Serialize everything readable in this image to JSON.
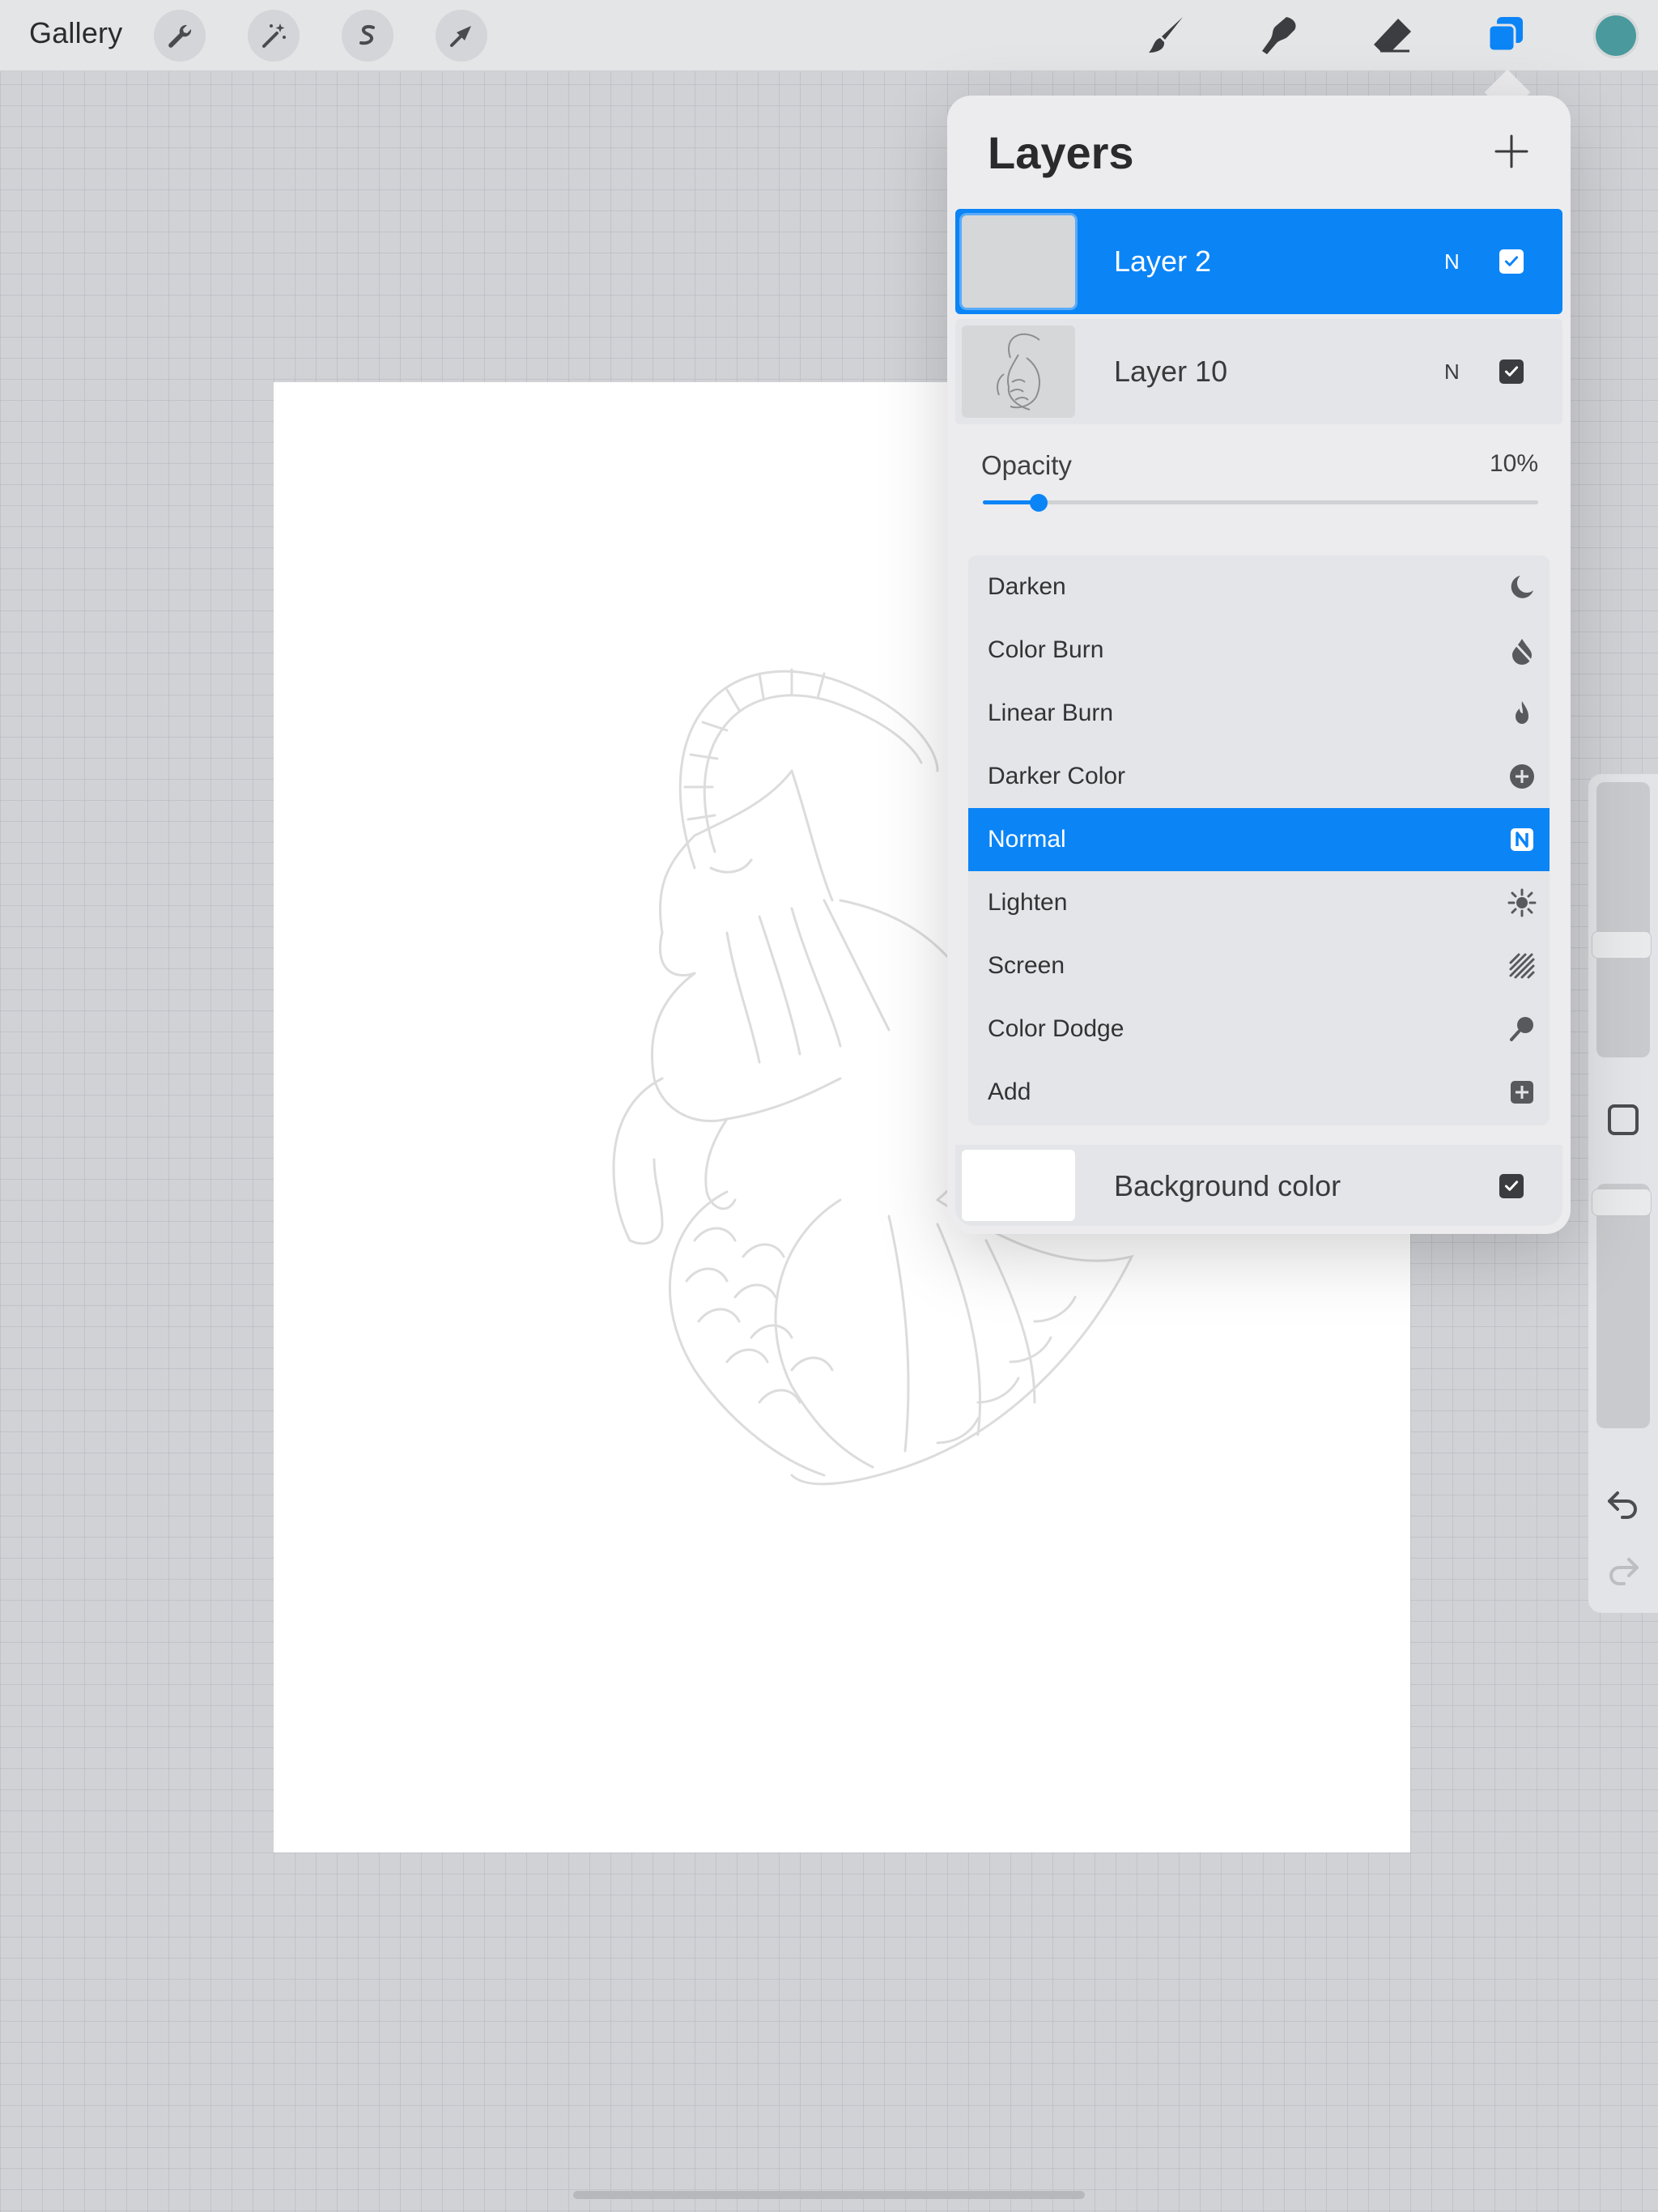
{
  "toolbar": {
    "gallery_label": "Gallery",
    "left_tools": [
      "wrench-icon",
      "magic-wand-icon",
      "selection-icon",
      "transform-arrow-icon"
    ],
    "right_tools": [
      "brush-icon",
      "smudge-icon",
      "eraser-icon",
      "layers-icon"
    ],
    "active_tool": "layers-icon",
    "current_color": "#4a9a9d",
    "accent_color": "#0b84f6"
  },
  "layers_panel": {
    "title": "Layers",
    "add_icon": "plus-icon",
    "layers": [
      {
        "name": "Layer 2",
        "blend": "N",
        "visible": true,
        "selected": true
      },
      {
        "name": "Layer 10",
        "blend": "N",
        "visible": true,
        "selected": false
      }
    ],
    "opacity": {
      "label": "Opacity",
      "value": "10%",
      "fraction": 0.1
    },
    "blend_modes": [
      {
        "label": "Darken",
        "icon": "moon-icon"
      },
      {
        "label": "Color Burn",
        "icon": "burn-drop-icon"
      },
      {
        "label": "Linear Burn",
        "icon": "flame-icon"
      },
      {
        "label": "Darker Color",
        "icon": "plus-circle-icon"
      },
      {
        "label": "Normal",
        "icon": "n-box-icon",
        "active": true
      },
      {
        "label": "Lighten",
        "icon": "sun-icon"
      },
      {
        "label": "Screen",
        "icon": "stripes-icon"
      },
      {
        "label": "Color Dodge",
        "icon": "dodge-icon"
      },
      {
        "label": "Add",
        "icon": "plus-square-icon"
      }
    ],
    "background": {
      "name": "Background color",
      "visible": true
    }
  },
  "sidebar": {
    "size_slider_fraction": 0.62,
    "opacity_slider_fraction": 0.0,
    "icons": [
      "modify-square-icon",
      "undo-icon",
      "redo-icon"
    ]
  }
}
